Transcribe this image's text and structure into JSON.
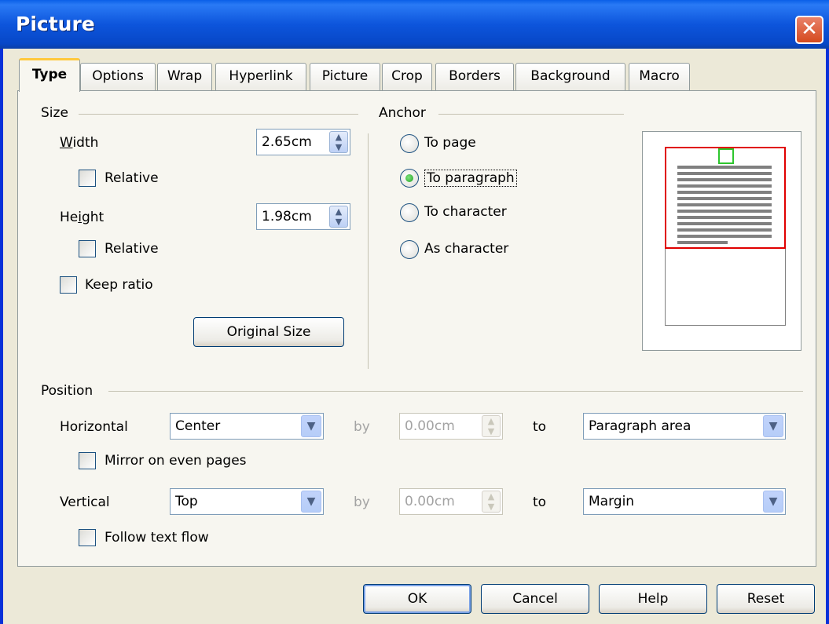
{
  "window": {
    "title": "Picture",
    "close": "✕"
  },
  "tabs": [
    "Type",
    "Options",
    "Wrap",
    "Hyperlink",
    "Picture",
    "Crop",
    "Borders",
    "Background",
    "Macro"
  ],
  "size": {
    "heading": "Size",
    "width_label": "Width",
    "width_value": "2.65cm",
    "width_relative": "Relative",
    "height_label": "Height",
    "height_value": "1.98cm",
    "height_relative": "Relative",
    "keep_ratio": "Keep ratio",
    "original_size": "Original Size"
  },
  "anchor": {
    "heading": "Anchor",
    "options": [
      "To page",
      "To paragraph",
      "To character",
      "As character"
    ],
    "selected": "To paragraph"
  },
  "position": {
    "heading": "Position",
    "horizontal_label": "Horizontal",
    "horizontal_value": "Center",
    "horizontal_by_label": "by",
    "horizontal_by_value": "0.00cm",
    "horizontal_to_label": "to",
    "horizontal_to_value": "Paragraph area",
    "mirror": "Mirror on even pages",
    "vertical_label": "Vertical",
    "vertical_value": "Top",
    "vertical_by_label": "by",
    "vertical_by_value": "0.00cm",
    "vertical_to_label": "to",
    "vertical_to_value": "Margin",
    "follow_text_flow": "Follow text flow"
  },
  "buttons": {
    "ok": "OK",
    "cancel": "Cancel",
    "help": "Help",
    "reset": "Reset"
  },
  "colors": {
    "titlebar": "#0a5fe8",
    "accent_tab": "#ffc83c",
    "preview_paragraph": "#e00000",
    "preview_frame": "#2ec62e"
  }
}
